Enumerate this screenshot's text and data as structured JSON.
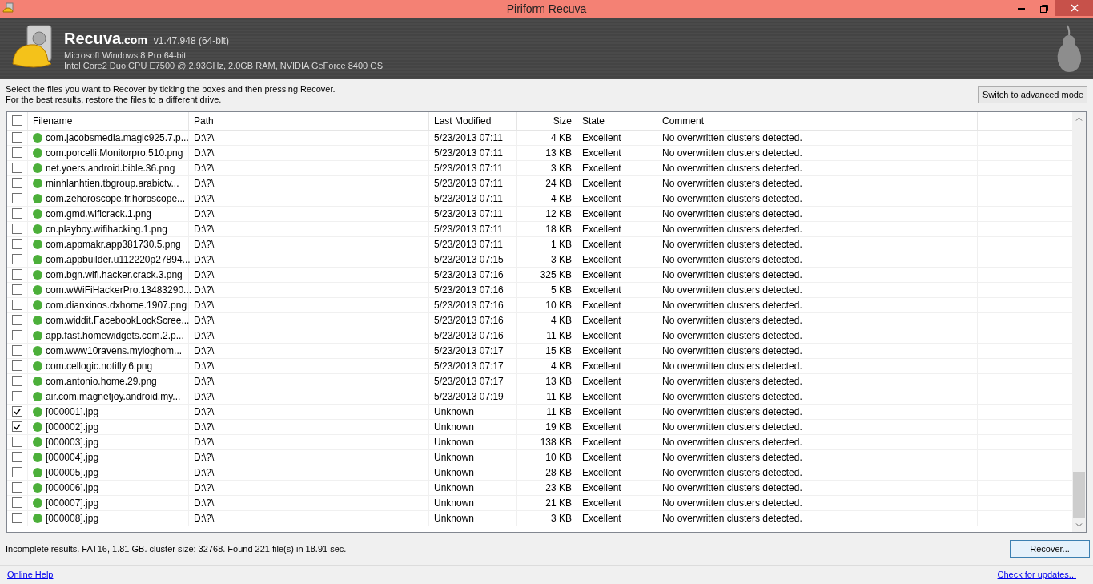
{
  "window": {
    "title": "Piriform Recuva"
  },
  "header": {
    "brand": "Recuva",
    "brand_suffix": ".com",
    "version": "v1.47.948 (64-bit)",
    "os": "Microsoft Windows 8 Pro 64-bit",
    "hardware": "Intel Core2 Duo CPU E7500 @ 2.93GHz, 2.0GB RAM, NVIDIA GeForce 8400 GS"
  },
  "instructions": [
    "Select the files you want to Recover by ticking the boxes and then pressing Recover.",
    "For the best results, restore the files to a different drive."
  ],
  "advanced_button": "Switch to advanced mode",
  "table": {
    "select_all_checked": false,
    "columns": [
      "Filename",
      "Path",
      "Last Modified",
      "Size",
      "State",
      "Comment"
    ],
    "rows": [
      {
        "checked": false,
        "filename": "com.jacobsmedia.magic925.7.p...",
        "path": "D:\\?\\",
        "modified": "5/23/2013 07:11",
        "size": "4 KB",
        "state": "Excellent",
        "comment": "No overwritten clusters detected."
      },
      {
        "checked": false,
        "filename": "com.porcelli.Monitorpro.510.png",
        "path": "D:\\?\\",
        "modified": "5/23/2013 07:11",
        "size": "13 KB",
        "state": "Excellent",
        "comment": "No overwritten clusters detected."
      },
      {
        "checked": false,
        "filename": "net.yoers.android.bible.36.png",
        "path": "D:\\?\\",
        "modified": "5/23/2013 07:11",
        "size": "3 KB",
        "state": "Excellent",
        "comment": "No overwritten clusters detected."
      },
      {
        "checked": false,
        "filename": "minhlanhtien.tbgroup.arabictv...",
        "path": "D:\\?\\",
        "modified": "5/23/2013 07:11",
        "size": "24 KB",
        "state": "Excellent",
        "comment": "No overwritten clusters detected."
      },
      {
        "checked": false,
        "filename": "com.zehoroscope.fr.horoscope...",
        "path": "D:\\?\\",
        "modified": "5/23/2013 07:11",
        "size": "4 KB",
        "state": "Excellent",
        "comment": "No overwritten clusters detected."
      },
      {
        "checked": false,
        "filename": "com.gmd.wificrack.1.png",
        "path": "D:\\?\\",
        "modified": "5/23/2013 07:11",
        "size": "12 KB",
        "state": "Excellent",
        "comment": "No overwritten clusters detected."
      },
      {
        "checked": false,
        "filename": "cn.playboy.wifihacking.1.png",
        "path": "D:\\?\\",
        "modified": "5/23/2013 07:11",
        "size": "18 KB",
        "state": "Excellent",
        "comment": "No overwritten clusters detected."
      },
      {
        "checked": false,
        "filename": "com.appmakr.app381730.5.png",
        "path": "D:\\?\\",
        "modified": "5/23/2013 07:11",
        "size": "1 KB",
        "state": "Excellent",
        "comment": "No overwritten clusters detected."
      },
      {
        "checked": false,
        "filename": "com.appbuilder.u112220p27894...",
        "path": "D:\\?\\",
        "modified": "5/23/2013 07:15",
        "size": "3 KB",
        "state": "Excellent",
        "comment": "No overwritten clusters detected."
      },
      {
        "checked": false,
        "filename": "com.bgn.wifi.hacker.crack.3.png",
        "path": "D:\\?\\",
        "modified": "5/23/2013 07:16",
        "size": "325 KB",
        "state": "Excellent",
        "comment": "No overwritten clusters detected."
      },
      {
        "checked": false,
        "filename": "com.wWiFiHackerPro.13483290...",
        "path": "D:\\?\\",
        "modified": "5/23/2013 07:16",
        "size": "5 KB",
        "state": "Excellent",
        "comment": "No overwritten clusters detected."
      },
      {
        "checked": false,
        "filename": "com.dianxinos.dxhome.1907.png",
        "path": "D:\\?\\",
        "modified": "5/23/2013 07:16",
        "size": "10 KB",
        "state": "Excellent",
        "comment": "No overwritten clusters detected."
      },
      {
        "checked": false,
        "filename": "com.widdit.FacebookLockScree...",
        "path": "D:\\?\\",
        "modified": "5/23/2013 07:16",
        "size": "4 KB",
        "state": "Excellent",
        "comment": "No overwritten clusters detected."
      },
      {
        "checked": false,
        "filename": "app.fast.homewidgets.com.2.p...",
        "path": "D:\\?\\",
        "modified": "5/23/2013 07:16",
        "size": "11 KB",
        "state": "Excellent",
        "comment": "No overwritten clusters detected."
      },
      {
        "checked": false,
        "filename": "com.www10ravens.myloghom...",
        "path": "D:\\?\\",
        "modified": "5/23/2013 07:17",
        "size": "15 KB",
        "state": "Excellent",
        "comment": "No overwritten clusters detected."
      },
      {
        "checked": false,
        "filename": "com.cellogic.notifly.6.png",
        "path": "D:\\?\\",
        "modified": "5/23/2013 07:17",
        "size": "4 KB",
        "state": "Excellent",
        "comment": "No overwritten clusters detected."
      },
      {
        "checked": false,
        "filename": "com.antonio.home.29.png",
        "path": "D:\\?\\",
        "modified": "5/23/2013 07:17",
        "size": "13 KB",
        "state": "Excellent",
        "comment": "No overwritten clusters detected."
      },
      {
        "checked": false,
        "filename": "air.com.magnetjoy.android.my...",
        "path": "D:\\?\\",
        "modified": "5/23/2013 07:19",
        "size": "11 KB",
        "state": "Excellent",
        "comment": "No overwritten clusters detected."
      },
      {
        "checked": true,
        "filename": "[000001].jpg",
        "path": "D:\\?\\",
        "modified": "Unknown",
        "size": "11 KB",
        "state": "Excellent",
        "comment": "No overwritten clusters detected."
      },
      {
        "checked": true,
        "filename": "[000002].jpg",
        "path": "D:\\?\\",
        "modified": "Unknown",
        "size": "19 KB",
        "state": "Excellent",
        "comment": "No overwritten clusters detected."
      },
      {
        "checked": false,
        "filename": "[000003].jpg",
        "path": "D:\\?\\",
        "modified": "Unknown",
        "size": "138 KB",
        "state": "Excellent",
        "comment": "No overwritten clusters detected."
      },
      {
        "checked": false,
        "filename": "[000004].jpg",
        "path": "D:\\?\\",
        "modified": "Unknown",
        "size": "10 KB",
        "state": "Excellent",
        "comment": "No overwritten clusters detected."
      },
      {
        "checked": false,
        "filename": "[000005].jpg",
        "path": "D:\\?\\",
        "modified": "Unknown",
        "size": "28 KB",
        "state": "Excellent",
        "comment": "No overwritten clusters detected."
      },
      {
        "checked": false,
        "filename": "[000006].jpg",
        "path": "D:\\?\\",
        "modified": "Unknown",
        "size": "23 KB",
        "state": "Excellent",
        "comment": "No overwritten clusters detected."
      },
      {
        "checked": false,
        "filename": "[000007].jpg",
        "path": "D:\\?\\",
        "modified": "Unknown",
        "size": "21 KB",
        "state": "Excellent",
        "comment": "No overwritten clusters detected."
      },
      {
        "checked": false,
        "filename": "[000008].jpg",
        "path": "D:\\?\\",
        "modified": "Unknown",
        "size": "3 KB",
        "state": "Excellent",
        "comment": "No overwritten clusters detected."
      }
    ]
  },
  "status": "Incomplete results. FAT16, 1.81 GB. cluster size: 32768. Found 221 file(s) in 18.91 sec.",
  "recover_button": "Recover...",
  "footer": {
    "help_link": "Online Help",
    "update_link": "Check for updates..."
  }
}
